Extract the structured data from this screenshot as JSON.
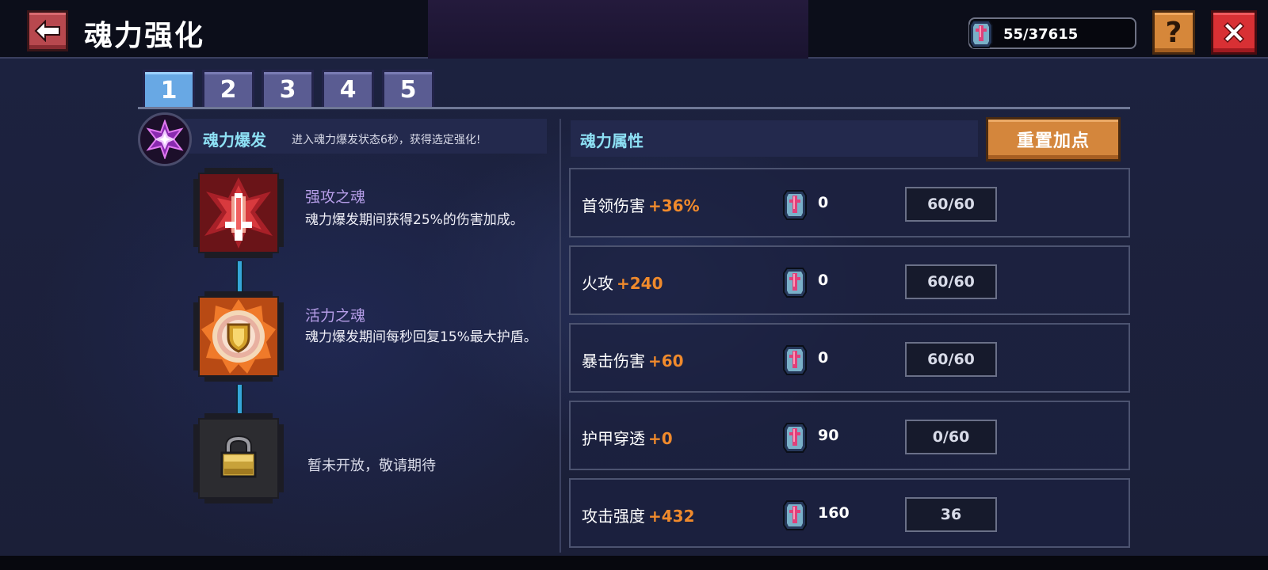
{
  "header": {
    "title": "魂力强化",
    "currency_value": "55/37615",
    "help_label": "?"
  },
  "tabs": [
    {
      "label": "1",
      "active": true
    },
    {
      "label": "2",
      "active": false
    },
    {
      "label": "3",
      "active": false
    },
    {
      "label": "4",
      "active": false
    },
    {
      "label": "5",
      "active": false
    }
  ],
  "burst": {
    "title": "魂力爆发",
    "description": "进入魂力爆发状态6秒，获得选定强化!"
  },
  "skills": [
    {
      "name": "强攻之魂",
      "description": "魂力爆发期间获得25%的伤害加成。",
      "icon": "attack-soul-icon"
    },
    {
      "name": "活力之魂",
      "description": "魂力爆发期间每秒回复15%最大护盾。",
      "icon": "vitality-soul-icon"
    },
    {
      "name": "",
      "description": "暂未开放，敬请期待",
      "icon": "lock-icon",
      "locked": true
    }
  ],
  "attributes": {
    "title": "魂力属性",
    "reset_label": "重置加点",
    "rows": [
      {
        "label": "首领伤害",
        "bonus": "+36%",
        "cost": "0",
        "level": "60/60"
      },
      {
        "label": "火攻",
        "bonus": "+240",
        "cost": "0",
        "level": "60/60"
      },
      {
        "label": "暴击伤害",
        "bonus": "+60",
        "cost": "0",
        "level": "60/60"
      },
      {
        "label": "护甲穿透",
        "bonus": "+0",
        "cost": "90",
        "level": "0/60"
      },
      {
        "label": "攻击强度",
        "bonus": "+432",
        "cost": "160",
        "level": "36"
      }
    ]
  },
  "colors": {
    "accent_cyan": "#8de0f4",
    "bonus_orange": "#f08a2c",
    "skill_name_purple": "#b69ee8",
    "tab_active": "#68a8e4",
    "tab_inactive": "#5a5c92"
  }
}
